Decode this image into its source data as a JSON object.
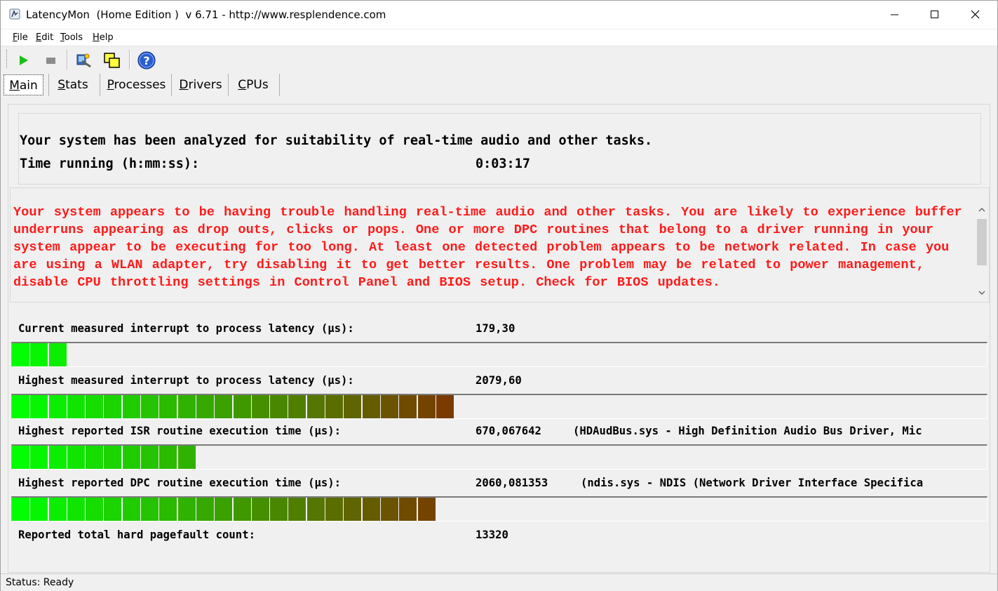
{
  "window": {
    "title": "LatencyMon  (Home Edition )  v 6.71 - http://www.resplendence.com"
  },
  "menu": [
    "File",
    "Edit",
    "Tools",
    "Help"
  ],
  "toolbar": {
    "buttons": [
      "play-icon",
      "stop-icon",
      "analyze-icon",
      "windows-icon",
      "help-icon"
    ]
  },
  "tabs": [
    {
      "label": "Main",
      "active": true
    },
    {
      "label": "Stats",
      "active": false
    },
    {
      "label": "Processes",
      "active": false
    },
    {
      "label": "Drivers",
      "active": false
    },
    {
      "label": "CPUs",
      "active": false
    }
  ],
  "summary": {
    "headline": "Your system has been analyzed for suitability of real-time audio and other tasks.",
    "time_label": "Time running (h:mm:ss):",
    "time_value": "0:03:17"
  },
  "message": {
    "color": "#ff1a1a",
    "text": "Your system appears to be having trouble handling real-time audio and other tasks. You are likely to experience buffer underruns appearing as drop outs, clicks or pops. One or more DPC routines that belong to a driver running in your system appear to be executing for too long. At least one detected problem appears to be network related. In case you are using a WLAN adapter, try disabling it to get better results. One problem may be related to power management, disable CPU throttling settings in Control Panel and BIOS setup. Check for BIOS updates."
  },
  "metrics": [
    {
      "label": "Current measured interrupt to process latency (µs):",
      "value": "179,30",
      "extra": "",
      "bar_segments": 3
    },
    {
      "label": "Highest measured interrupt to process latency (µs):",
      "value": "2079,60",
      "extra": "",
      "bar_segments": 24
    },
    {
      "label": "Highest reported ISR routine execution time (µs):",
      "value": "670,067642",
      "extra": "(HDAudBus.sys - High Definition Audio Bus Driver, Mic",
      "bar_segments": 10
    },
    {
      "label": "Highest reported DPC routine execution time (µs):",
      "value": "2060,081353",
      "extra": "(ndis.sys - NDIS (Network Driver Interface Specifica",
      "bar_segments": 23
    },
    {
      "label": "Reported total hard pagefault count:",
      "value": "13320",
      "extra": ""
    }
  ],
  "colors": {
    "bar_start": "#00ff00",
    "bar_end": "#7a3a00"
  },
  "status": {
    "text": "Status: Ready"
  }
}
